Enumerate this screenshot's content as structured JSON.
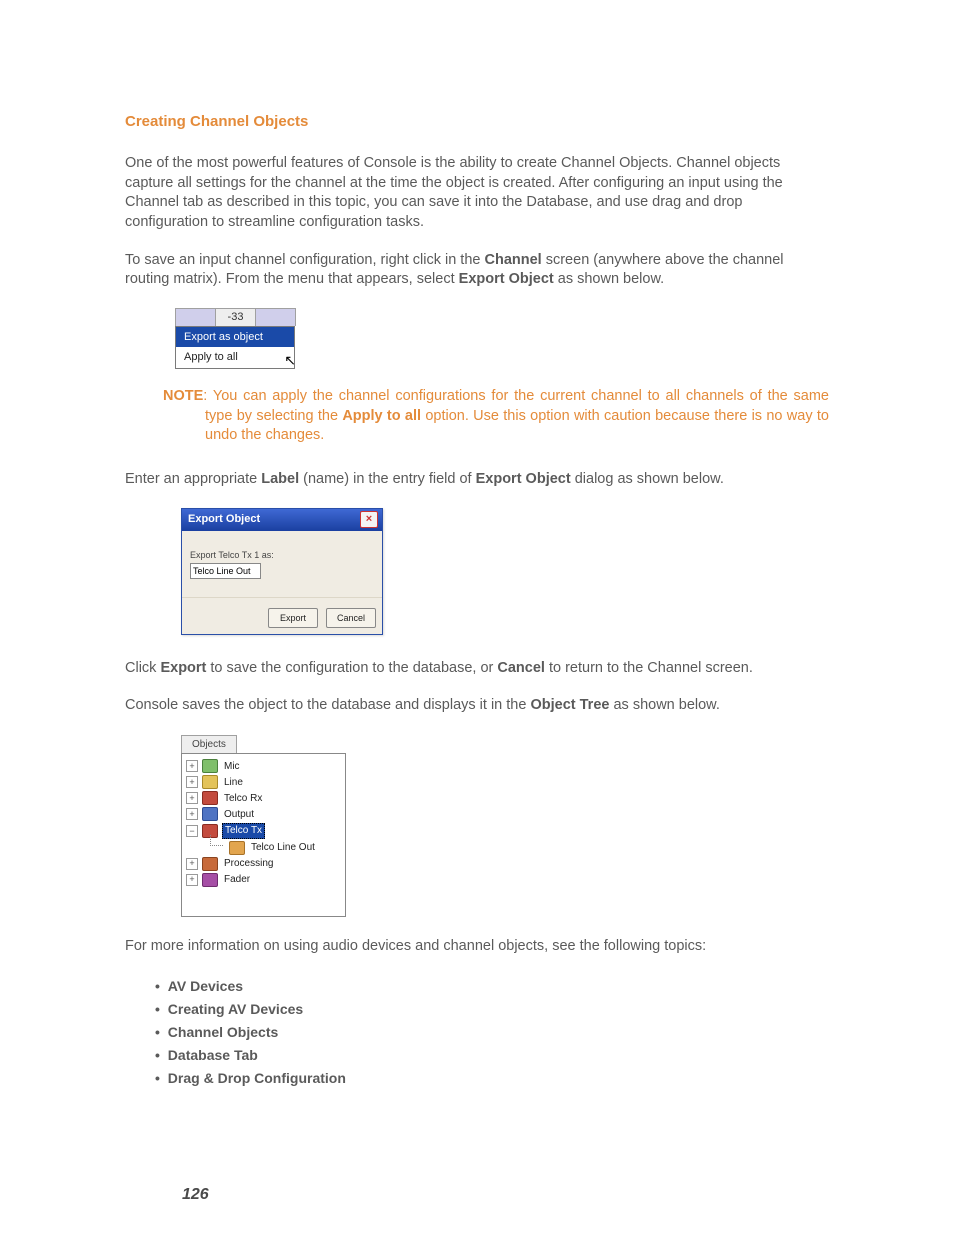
{
  "heading": "Creating Channel Objects",
  "para1": "One of the most powerful features of Console is the ability to create Channel Objects. Channel objects capture all settings for the channel at the time the object is created. After configuring an input using the Channel tab as described in this topic, you can save it into the Database, and use drag and drop configuration to streamline configuration tasks.",
  "para2_pre": "To save an input channel configuration, right click in the ",
  "para2_b1": "Channel",
  "para2_mid": " screen (anywhere above the channel routing matrix). From the menu that appears, select ",
  "para2_b2": "Export Object",
  "para2_post": " as shown below.",
  "context_menu": {
    "top_gain": "-33",
    "items": {
      "export": "Export as object",
      "apply": "Apply to all"
    }
  },
  "note": {
    "label": "NOTE",
    "text_pre": ": You can apply the channel configurations for the current channel to all channels of the same type by selecting the ",
    "bold": "Apply to all",
    "text_post": " option. Use this option with caution because there is no way to undo the changes."
  },
  "para3_pre": "Enter an appropriate ",
  "para3_b1": "Label",
  "para3_mid": " (name) in the entry field of ",
  "para3_b2": "Export Object",
  "para3_post": " dialog as shown below.",
  "export_dialog": {
    "title": "Export Object",
    "field_label": "Export Telco Tx 1 as:",
    "field_value": "Telco Line Out",
    "buttons": {
      "export": "Export",
      "cancel": "Cancel"
    }
  },
  "para4_pre": "Click ",
  "para4_b1": "Export",
  "para4_mid": " to save the configuration to the database, or ",
  "para4_b2": "Cancel",
  "para4_post": " to return to the Channel screen.",
  "para5_pre": "Console saves the object to the database and displays it in the ",
  "para5_b1": "Object Tree",
  "para5_post": " as shown below.",
  "object_tree": {
    "tab": "Objects",
    "items": {
      "mic": "Mic",
      "line": "Line",
      "telcorx": "Telco Rx",
      "output": "Output",
      "telcotx": "Telco Tx",
      "telcoline": "Telco Line Out",
      "proc": "Processing",
      "fader": "Fader"
    }
  },
  "para6": "For more information on using audio devices and channel objects, see the following topics:",
  "bullets": {
    "b1": "AV Devices",
    "b2": "Creating AV Devices",
    "b3": "Channel Objects",
    "b4": "Database Tab",
    "b5": "Drag & Drop Configuration"
  },
  "page_number": "126"
}
